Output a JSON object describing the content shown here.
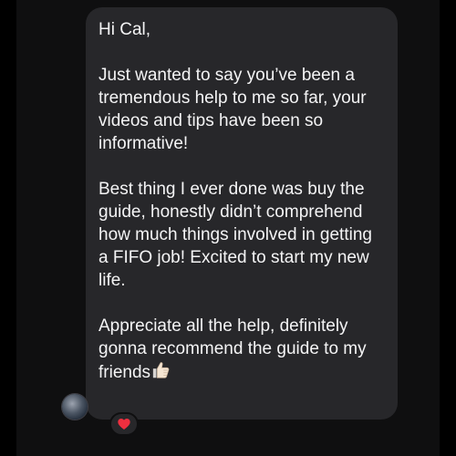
{
  "message": {
    "greeting": "Hi Cal,",
    "paragraphs": [
      "Just wanted to say you’ve been a tremendous help to me so far, your videos and tips have been so informative!",
      "Best thing I ever done was buy the guide, honestly didn’t comprehend how much things involved in getting a FIFO job! Excited to start my new life.",
      "Appreciate all the help, definitely gonna recommend the guide to my friends"
    ],
    "trailing_emoji": "thumbs-up-icon"
  },
  "reaction": {
    "icon": "heart-icon",
    "color": "#ef2f3f"
  },
  "sender": {
    "avatar": "avatar"
  },
  "colors": {
    "background": "#000000",
    "chat_background": "#0f0f10",
    "bubble": "#27272a",
    "text": "#f4f4f5"
  }
}
